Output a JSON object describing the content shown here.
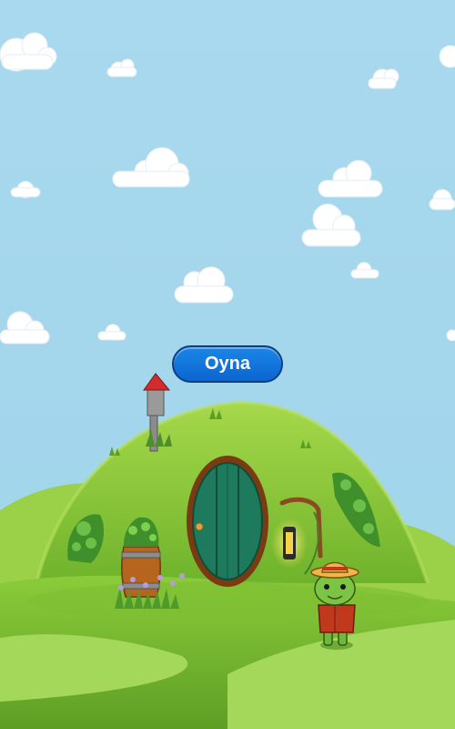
{
  "play_button": {
    "label": "Oyna"
  },
  "colors": {
    "sky": "#9fd4ea",
    "hill": "#8cc63f",
    "door": "#1e7a5c",
    "button": "#0b72e0"
  },
  "icons": {
    "lamp": "lantern-icon",
    "mailbox": "mailbox-icon",
    "character": "frog-character"
  }
}
